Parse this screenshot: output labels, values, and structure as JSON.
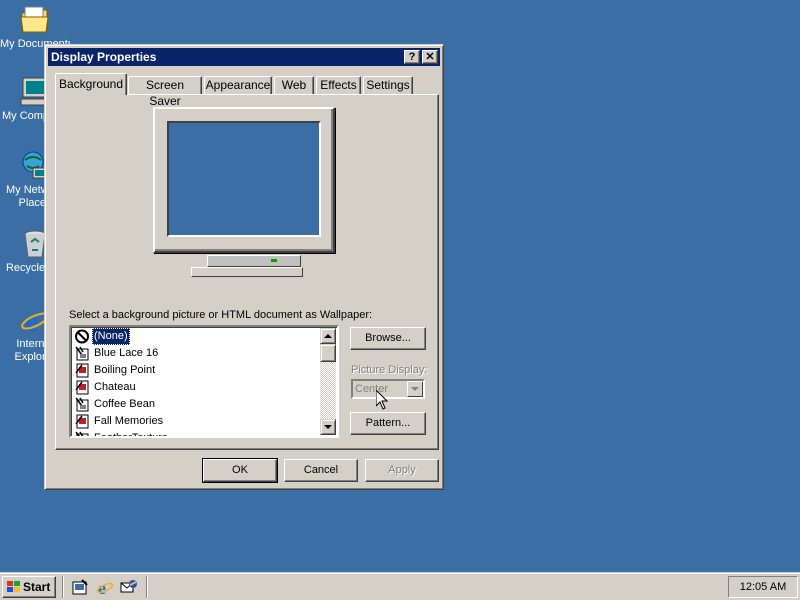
{
  "desktop": {
    "icons": [
      {
        "label": "My Documents",
        "icon": "folder-icon"
      },
      {
        "label": "My Computer",
        "icon": "computer-icon"
      },
      {
        "label": "My Network Places",
        "icon": "network-icon"
      },
      {
        "label": "Recycle Bin",
        "icon": "recycle-bin-icon"
      },
      {
        "label": "Internet Explorer",
        "icon": "internet-explorer-icon"
      }
    ],
    "background_color": "#3a6ea5"
  },
  "window": {
    "title": "Display Properties",
    "help_label": "?",
    "close_label": "✕",
    "tabs": [
      {
        "label": "Background",
        "active": true
      },
      {
        "label": "Screen Saver",
        "active": false
      },
      {
        "label": "Appearance",
        "active": false
      },
      {
        "label": "Web",
        "active": false
      },
      {
        "label": "Effects",
        "active": false
      },
      {
        "label": "Settings",
        "active": false
      }
    ],
    "wallpaper_caption": "Select a background picture or HTML document as Wallpaper:",
    "wallpapers": [
      {
        "label": "(None)",
        "selected": true,
        "icon": "none-icon"
      },
      {
        "label": "Blue Lace 16",
        "selected": false,
        "icon": "bitmap-icon"
      },
      {
        "label": "Boiling Point",
        "selected": false,
        "icon": "html-document-icon"
      },
      {
        "label": "Chateau",
        "selected": false,
        "icon": "html-document-icon"
      },
      {
        "label": "Coffee Bean",
        "selected": false,
        "icon": "bitmap-icon"
      },
      {
        "label": "Fall Memories",
        "selected": false,
        "icon": "html-document-icon"
      },
      {
        "label": "FeatherTexture",
        "selected": false,
        "icon": "bitmap-icon"
      }
    ],
    "browse_label": "Browse...",
    "picture_display_label": "Picture Display:",
    "picture_display_value": "Center",
    "pattern_label": "Pattern...",
    "ok_label": "OK",
    "cancel_label": "Cancel",
    "apply_label": "Apply",
    "titlebar_color": "#0a246a"
  },
  "taskbar": {
    "start_label": "Start",
    "quick_launch": [
      "show-desktop-icon",
      "internet-explorer-icon",
      "outlook-express-icon"
    ],
    "clock": "12:05 AM"
  }
}
